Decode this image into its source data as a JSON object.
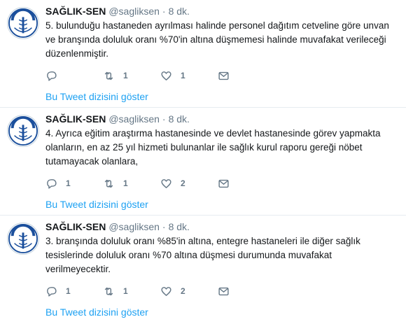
{
  "tweets": [
    {
      "name": "SAĞLIK-SEN",
      "handle": "@sagliksen",
      "separator": "·",
      "time": "8 dk.",
      "text": "5. bulunduğu hastaneden ayrılması halinde personel dağıtım cetveline göre unvan ve branşında doluluk oranı %70'in altına düşmemesi halinde muvafakat verileceği düzenlenmiştir.",
      "reply_count": "",
      "retweet_count": "1",
      "like_count": "1",
      "show_thread": "Bu Tweet dizisini göster"
    },
    {
      "name": "SAĞLIK-SEN",
      "handle": "@sagliksen",
      "separator": "·",
      "time": "8 dk.",
      "text": "4. Ayrıca eğitim araştırma hastanesinde ve devlet hastanesinde görev yapmakta olanların, en az 25 yıl hizmeti bulunanlar ile sağlık kurul raporu gereği nöbet tutamayacak olanlara,",
      "reply_count": "1",
      "retweet_count": "1",
      "like_count": "2",
      "show_thread": "Bu Tweet dizisini göster"
    },
    {
      "name": "SAĞLIK-SEN",
      "handle": "@sagliksen",
      "separator": "·",
      "time": "8 dk.",
      "text": "3. branşında doluluk oranı %85'in altına, entegre hastaneleri ile diğer sağlık tesislerinde doluluk oranı %70 altına düşmesi durumunda muvafakat verilmeyecektir.",
      "reply_count": "1",
      "retweet_count": "1",
      "like_count": "2",
      "show_thread": "Bu Tweet dizisini göster"
    }
  ],
  "avatar_logo_text": "SAĞLIK SEN",
  "icons": [
    "reply-icon",
    "retweet-icon",
    "like-icon",
    "direct-message-icon"
  ],
  "colors": {
    "link": "#1da1f2",
    "muted": "#657786",
    "text": "#14171a",
    "divider": "#e6ecf0",
    "logo_blue": "#1b4f9c"
  }
}
